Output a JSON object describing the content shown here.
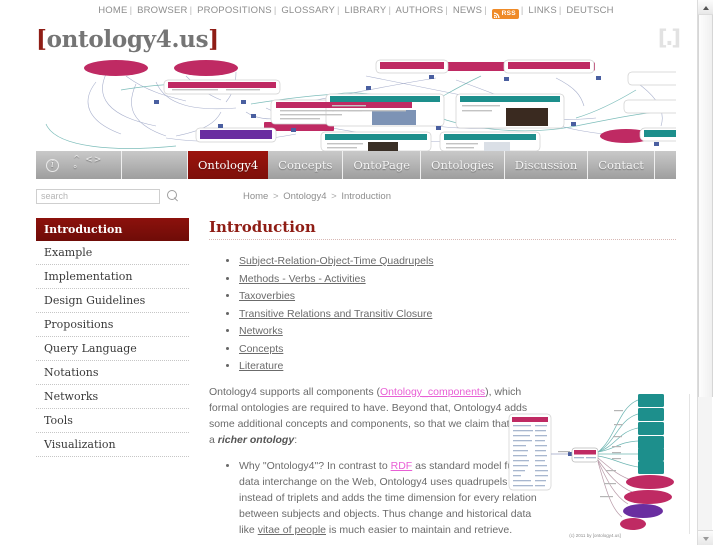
{
  "topnav": {
    "items": [
      "HOME",
      "BROWSER",
      "PROPOSITIONS",
      "GLOSSARY",
      "LIBRARY",
      "AUTHORS",
      "NEWS"
    ],
    "rss_label": "RSS",
    "items_after": [
      "LINKS",
      "DEUTSCH"
    ],
    "separator": "|"
  },
  "logo": {
    "open_bracket": "[",
    "word": "ontology4.us",
    "close_bracket": "]",
    "corner_mark": "[.]",
    "bracket_color": "#8f1d15",
    "word_color": "#757575"
  },
  "tabs": {
    "info_icon": "i",
    "symbols": "^ <> °",
    "items": [
      {
        "label": "Ontology4",
        "active": true
      },
      {
        "label": "Concepts",
        "active": false
      },
      {
        "label": "OntoPage",
        "active": false
      },
      {
        "label": "Ontologies",
        "active": false
      },
      {
        "label": "Discussion",
        "active": false
      },
      {
        "label": "Contact",
        "active": false
      }
    ],
    "active_color": "#8f1d15"
  },
  "search": {
    "placeholder": "search",
    "value": "",
    "icon": "search-icon"
  },
  "breadcrumb": {
    "home": "Home",
    "sep": ">",
    "section": "Ontology4",
    "page": "Introduction"
  },
  "sidebar": {
    "items": [
      {
        "label": "Introduction",
        "active": true
      },
      {
        "label": "Example",
        "active": false
      },
      {
        "label": "Implementation",
        "active": false
      },
      {
        "label": "Design Guidelines",
        "active": false
      },
      {
        "label": "Propositions",
        "active": false
      },
      {
        "label": "Query Language",
        "active": false
      },
      {
        "label": "Notations",
        "active": false
      },
      {
        "label": "Networks",
        "active": false
      },
      {
        "label": "Tools",
        "active": false
      },
      {
        "label": "Visualization",
        "active": false
      }
    ]
  },
  "main": {
    "title": "Introduction",
    "links": [
      "Subject-Relation-Object-Time Quadrupels",
      "Methods - Verbs - Activities",
      "Taxoverbies",
      "Transitive Relations and Transitiv Closure",
      "Networks",
      "Concepts",
      "Literature"
    ],
    "para1_a": "Ontology4 supports all components (",
    "para1_link": "Ontology_components",
    "para1_b": "), which formal ontologies are required to have. Beyond that, Ontology4 adds some additional concepts and components, so that we claim that it is a ",
    "para1_em": "richer ontology",
    "para1_c": ":",
    "bullet1_a": "Why \"Ontology4\"? In contrast to ",
    "bullet1_link1": "RDF",
    "bullet1_b": " as standard model für data interchange on the Web, Ontology4 uses quadrupels instead of triplets and adds the time dimension for every relation between subjects and objects. Thus change and historical data like ",
    "bullet1_link2": "vitae of people",
    "bullet1_c": " is much easier to maintain and retrieve.",
    "figure_caption": "(c) 2011 by [ontology4.us]"
  },
  "colors": {
    "accent_red": "#8f1d15",
    "tab_gray": "#a9a9a9",
    "link_pink": "#e85fd5",
    "teal": "#1d8f8c",
    "crimson": "#bf2a63",
    "purple": "#6a2ea0"
  }
}
